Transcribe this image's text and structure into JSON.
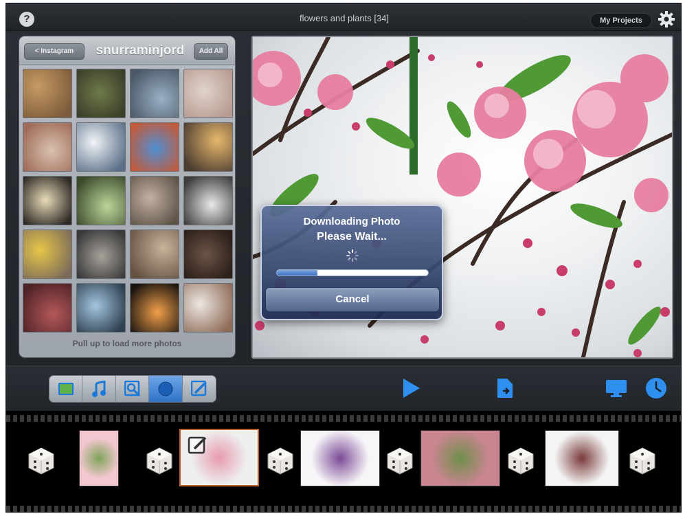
{
  "topbar": {
    "help_icon": "question-mark",
    "title": "flowers and plants  [34]",
    "my_projects_label": "My Projects",
    "settings_icon": "gear"
  },
  "photo_panel": {
    "back_label": "< Instagram",
    "username": "snurraminjord",
    "add_all_label": "Add All",
    "load_more_label": "Pull up to load more photos",
    "thumbnails": [
      {
        "c1": "#c69a63",
        "c2": "#7c5a3a"
      },
      {
        "c1": "#6f7a4a",
        "c2": "#3a3f2a"
      },
      {
        "c1": "#9ab0c6",
        "c2": "#4a5866"
      },
      {
        "c1": "#e0d4cc",
        "c2": "#b79b90"
      },
      {
        "c1": "#d8c2ae",
        "c2": "#a06b5a"
      },
      {
        "c1": "#f1f4f7",
        "c2": "#5a6f88"
      },
      {
        "c1": "#4f8fd3",
        "c2": "#c35a3a"
      },
      {
        "c1": "#e7b86d",
        "c2": "#4a3c30"
      },
      {
        "c1": "#e8dbb8",
        "c2": "#2f2a26"
      },
      {
        "c1": "#bcd59a",
        "c2": "#3b4a2b"
      },
      {
        "c1": "#c3b1a3",
        "c2": "#5f5348"
      },
      {
        "c1": "#e9e9e9",
        "c2": "#3d3d3d"
      },
      {
        "c1": "#e8c64a",
        "c2": "#7b6b59"
      },
      {
        "c1": "#a7a29b",
        "c2": "#3a3a3a"
      },
      {
        "c1": "#c7b49a",
        "c2": "#655243"
      },
      {
        "c1": "#6c5446",
        "c2": "#2b1f1a"
      },
      {
        "c1": "#b5585a",
        "c2": "#4e2326"
      },
      {
        "c1": "#a4c6e0",
        "c2": "#2e3f50"
      },
      {
        "c1": "#f2a04a",
        "c2": "#1a1410"
      },
      {
        "c1": "#ece7e2",
        "c2": "#8f6c58"
      }
    ]
  },
  "modal": {
    "line1": "Downloading Photo",
    "line2": "Please Wait...",
    "progress": 0.27,
    "cancel_label": "Cancel"
  },
  "toolbar": {
    "tools": [
      {
        "name": "photo",
        "icon": "landscape-icon",
        "active": false
      },
      {
        "name": "music",
        "icon": "music-note-icon",
        "active": false
      },
      {
        "name": "zoom",
        "icon": "zoom-icon",
        "active": false
      },
      {
        "name": "effect",
        "icon": "circle-icon",
        "active": true
      },
      {
        "name": "edit",
        "icon": "pencil-icon",
        "active": false
      }
    ],
    "play_icon": "play",
    "export_icon": "export",
    "tv_icon": "tv",
    "clock_icon": "clock",
    "accent": "#2f8ff0"
  },
  "filmstrip": {
    "photos": [
      {
        "c1": "#f2c7cf",
        "c2": "#7ea35a"
      },
      {
        "c1": "#eef0ee",
        "c2": "#e79ab0"
      },
      {
        "c1": "#f7f5f8",
        "c2": "#7b4a96"
      },
      {
        "c1": "#c98590",
        "c2": "#6f8f4a"
      },
      {
        "c1": "#f4f4f4",
        "c2": "#7a3a3a"
      }
    ]
  }
}
